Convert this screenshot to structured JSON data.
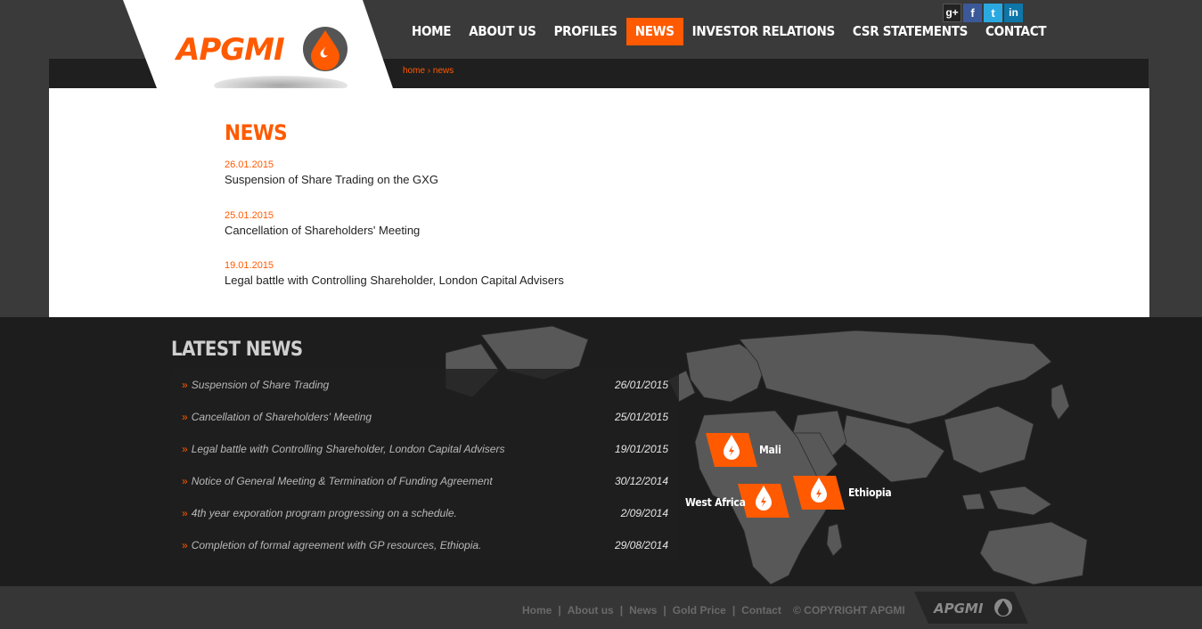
{
  "brand": {
    "name": "APGMI",
    "accent": "#ff5a00"
  },
  "nav": {
    "items": [
      {
        "label": "HOME",
        "active": false
      },
      {
        "label": "ABOUT US",
        "active": false
      },
      {
        "label": "PROFILES",
        "active": false
      },
      {
        "label": "NEWS",
        "active": true
      },
      {
        "label": "INVESTOR RELATIONS",
        "active": false
      },
      {
        "label": "CSR STATEMENTS",
        "active": false
      },
      {
        "label": "CONTACT",
        "active": false
      }
    ]
  },
  "social": [
    {
      "icon": "google-plus-icon",
      "glyph": "g+"
    },
    {
      "icon": "facebook-icon",
      "glyph": "f"
    },
    {
      "icon": "twitter-icon",
      "glyph": "t"
    },
    {
      "icon": "linkedin-icon",
      "glyph": "in"
    }
  ],
  "breadcrumb": {
    "home": "home",
    "sep": " › ",
    "current": "news"
  },
  "news": {
    "title": "NEWS",
    "items": [
      {
        "date": "26.01.2015",
        "title": "Suspension of Share Trading on the GXG"
      },
      {
        "date": "25.01.2015",
        "title": "Cancellation of Shareholders' Meeting"
      },
      {
        "date": "19.01.2015",
        "title": "Legal battle with Controlling Shareholder, London Capital Advisers"
      }
    ]
  },
  "latest": {
    "title": "LATEST NEWS",
    "marker": "»",
    "items": [
      {
        "text": "Suspension of Share Trading",
        "date": "26/01/2015"
      },
      {
        "text": "Cancellation of Shareholders' Meeting",
        "date": "25/01/2015"
      },
      {
        "text": "Legal battle with Controlling Shareholder, London Capital Advisers",
        "date": "19/01/2015"
      },
      {
        "text": "Notice of General Meeting & Termination of Funding Agreement",
        "date": "30/12/2014"
      },
      {
        "text": "4th year exporation program progressing on a schedule.",
        "date": "2/09/2014"
      },
      {
        "text": "Completion of formal agreement with GP resources, Ethiopia.",
        "date": "29/08/2014"
      }
    ]
  },
  "map": {
    "regions": [
      {
        "label": "Mali"
      },
      {
        "label": "West Africa"
      },
      {
        "label": "Ethiopia"
      }
    ]
  },
  "footer": {
    "links": [
      "Home",
      "About us",
      "News",
      "Gold Price",
      "Contact"
    ],
    "separator": "|",
    "copyright": "© COPYRIGHT APGMI"
  }
}
